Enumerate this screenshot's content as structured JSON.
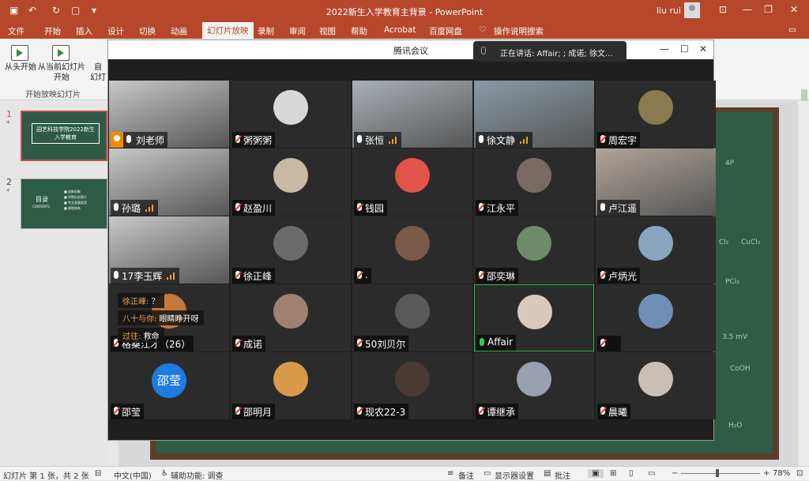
{
  "app": {
    "doc_title": "2022新生入学教育主背景 - PowerPoint",
    "user": "liu rui"
  },
  "ribbon_tabs": [
    "文件",
    "开始",
    "插入",
    "设计",
    "切换",
    "动画",
    "幻灯片放映",
    "录制",
    "审阅",
    "视图",
    "帮助",
    "Acrobat",
    "百度网盘",
    "操作说明搜索"
  ],
  "ribbon": {
    "from_start": "从头开始",
    "from_current": "从当前幻灯片开始",
    "partial": "自",
    "partial2": "幻灯",
    "group_label": "开始放映幻灯片"
  },
  "slides": [
    {
      "num": "1",
      "star": "*",
      "title": "园艺科技学院2022新生入学教育"
    },
    {
      "num": "2",
      "star": "*",
      "title": "目录",
      "sub": "CONTENTS",
      "items": [
        "■ 迎新欢聚",
        "■ 学院历史简介",
        "■ 专业发展现状",
        "■ 课程体系"
      ]
    }
  ],
  "slide_chalk": [
    "4P",
    "Cl₂",
    "CuCl₂",
    "PCl₃",
    "3.5 mV",
    "CoOH",
    "H₂O"
  ],
  "meeting": {
    "title": "腾讯会议",
    "speaking": "正在讲话: Affair; ; 成诺; 徐文...",
    "tiles": [
      {
        "name": "刘老师",
        "type": "video",
        "host": true
      },
      {
        "name": "粥粥粥",
        "type": "avatar",
        "color": "#d8d8d8"
      },
      {
        "name": "张恒",
        "type": "video",
        "bars": true
      },
      {
        "name": "徐文静",
        "type": "video",
        "bars": true
      },
      {
        "name": "周宏宇",
        "type": "avatar",
        "color": "#8a7a50"
      },
      {
        "name": "孙璐",
        "type": "video",
        "bars": true
      },
      {
        "name": "赵盈川",
        "type": "avatar",
        "color": "#c9b8a4"
      },
      {
        "name": "钱园",
        "type": "avatar",
        "color": "#e2534a"
      },
      {
        "name": "江永平",
        "type": "avatar",
        "color": "#7a6a66"
      },
      {
        "name": "卢江遥",
        "type": "video"
      },
      {
        "name": "17李玉辉",
        "type": "video",
        "bars": true
      },
      {
        "name": "徐正峰",
        "type": "avatar",
        "color": "#6b6b6b"
      },
      {
        "name": ".",
        "type": "avatar",
        "color": "#7a5a4a"
      },
      {
        "name": "邵奕琳",
        "type": "avatar",
        "color": "#6e8b6a"
      },
      {
        "name": "卢炳光",
        "type": "avatar",
        "color": "#8aa4c0"
      },
      {
        "name": "格桑江才（26）",
        "type": "avatar",
        "color": "#c4783a"
      },
      {
        "name": "成诺",
        "type": "avatar",
        "color": "#a08070"
      },
      {
        "name": "50刘贝尔",
        "type": "avatar",
        "color": "#5a5a5a"
      },
      {
        "name": "Affair",
        "type": "avatar",
        "color": "#d9c8bc",
        "active": true
      },
      {
        "name": "",
        "type": "avatar",
        "color": "#6f8fb8"
      },
      {
        "name": "邵莹",
        "type": "initial",
        "initial": "邵莹"
      },
      {
        "name": "邵明月",
        "type": "avatar",
        "color": "#d89a4a"
      },
      {
        "name": "现农22-3",
        "type": "avatar",
        "color": "#4a3a34"
      },
      {
        "name": "谭继承",
        "type": "avatar",
        "color": "#9aa0b0"
      },
      {
        "name": "晨曦",
        "type": "avatar",
        "color": "#c8bfb8"
      }
    ],
    "chat": [
      {
        "sender": "徐正峰:",
        "text": "？"
      },
      {
        "sender": "八十与你:",
        "text": "眼睛睁开呀"
      },
      {
        "sender": "过往:",
        "text": "救命"
      }
    ]
  },
  "status": {
    "slide_info": "幻灯片 第 1 张，共 2 张",
    "language": "中文(中国)",
    "accessibility": "辅助功能: 调查",
    "notes": "备注",
    "display": "显示器设置",
    "comments": "批注",
    "zoom": "78%"
  }
}
